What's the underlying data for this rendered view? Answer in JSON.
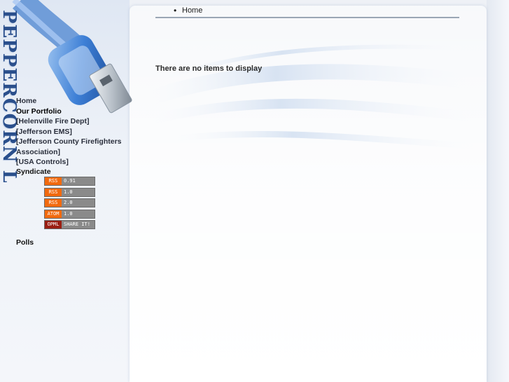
{
  "logo": {
    "text": "PEPPERCORN LOGIC"
  },
  "breadcrumb": {
    "items": [
      "Home"
    ]
  },
  "main": {
    "empty_message": "There are no items to display"
  },
  "nav": {
    "items": [
      {
        "label": "Home"
      },
      {
        "label": "Our Portfolio"
      },
      {
        "label": "[Helenville Fire Dept]"
      },
      {
        "label": "[Jefferson EMS]"
      },
      {
        "label": "[Jefferson County Firefighters"
      },
      {
        "label": "Association]"
      },
      {
        "label": "[USA Controls]"
      }
    ]
  },
  "syndicate": {
    "heading": "Syndicate",
    "feeds": [
      {
        "left": "RSS",
        "right": "0.91",
        "left_color": "#f26a0f"
      },
      {
        "left": "RSS",
        "right": "1.0",
        "left_color": "#f26a0f"
      },
      {
        "left": "RSS",
        "right": "2.0",
        "left_color": "#f26a0f"
      },
      {
        "left": "ATOM",
        "right": "1.0",
        "left_color": "#f26a0f"
      },
      {
        "left": "OPML",
        "right": "SHARE IT!",
        "left_color": "#9a1e12"
      }
    ]
  },
  "polls": {
    "heading": "Polls"
  },
  "colors": {
    "logo_blue": "#2a4f8c",
    "cable_blue": "#3d7fd6"
  }
}
